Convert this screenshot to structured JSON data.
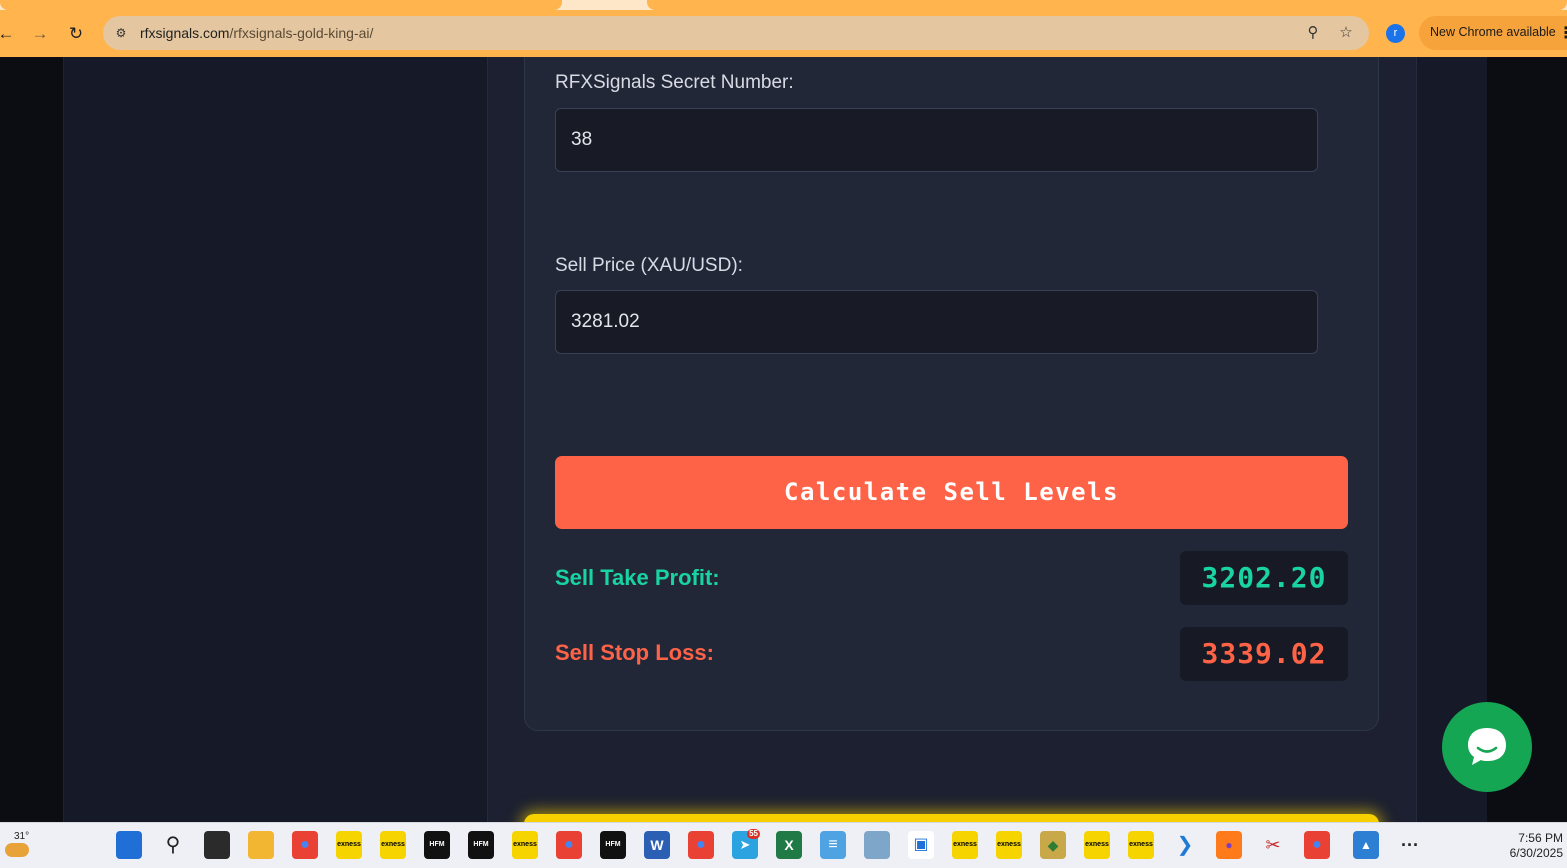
{
  "browser": {
    "url_domain": "rfxsignals.com",
    "url_path": "/rfxsignals-gold-king-ai/",
    "profile_initial": "r",
    "update_label": "New Chrome available",
    "theme_color": "#ffb44d"
  },
  "form": {
    "secret_label": "RFXSignals Secret Number:",
    "secret_value": "38",
    "sell_price_label": "Sell Price (XAU/USD):",
    "sell_price_value": "3281.02",
    "calculate_label": "Calculate Sell Levels"
  },
  "results": {
    "take_profit_label": "Sell Take Profit:",
    "take_profit_value": "3202.20",
    "take_profit_color": "#19d3a2",
    "stop_loss_label": "Sell Stop Loss:",
    "stop_loss_value": "3339.02",
    "stop_loss_color": "#ff6347"
  },
  "taskbar": {
    "weather_temp": "31°",
    "time": "7:56 PM",
    "date": "6/30/2025",
    "apps": [
      {
        "name": "start-icon"
      },
      {
        "name": "search-icon"
      },
      {
        "name": "task-view-icon"
      },
      {
        "name": "file-explorer-icon"
      },
      {
        "name": "chrome-icon"
      },
      {
        "name": "exness-icon"
      },
      {
        "name": "exness-icon"
      },
      {
        "name": "hfm-icon",
        "label": "HFM"
      },
      {
        "name": "hfm-icon",
        "label": "HFM"
      },
      {
        "name": "exness-icon"
      },
      {
        "name": "chrome-icon"
      },
      {
        "name": "hfm-icon",
        "label": "HFM"
      },
      {
        "name": "word-icon"
      },
      {
        "name": "chrome-icon"
      },
      {
        "name": "telegram-icon",
        "badge": "55"
      },
      {
        "name": "excel-icon"
      },
      {
        "name": "notepad-icon"
      },
      {
        "name": "control-panel-icon"
      },
      {
        "name": "window-icon"
      },
      {
        "name": "exness-icon"
      },
      {
        "name": "exness-icon"
      },
      {
        "name": "paint-icon"
      },
      {
        "name": "exness-icon"
      },
      {
        "name": "exness-icon"
      },
      {
        "name": "vscode-icon"
      },
      {
        "name": "firefox-icon"
      },
      {
        "name": "snipping-tool-icon"
      },
      {
        "name": "chrome-icon"
      },
      {
        "name": "photos-icon"
      },
      {
        "name": "more-icon"
      }
    ]
  }
}
